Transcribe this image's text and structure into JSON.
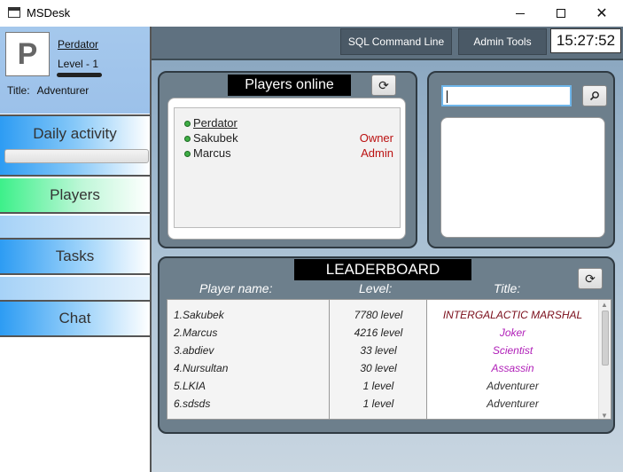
{
  "window": {
    "title": "MSDesk"
  },
  "profile": {
    "avatar_letter": "P",
    "name": "Perdator",
    "level": "Level - 1",
    "title_label": "Title:",
    "title_value": "Adventurer"
  },
  "nav": {
    "daily": "Daily activity",
    "players": "Players",
    "tasks": "Tasks",
    "chat": "Chat"
  },
  "toolbar": {
    "sql": "SQL Command Line",
    "admin": "Admin Tools",
    "clock": "15:27:52"
  },
  "players_online": {
    "title": "Players online",
    "players": [
      {
        "name": "Perdator",
        "role": ""
      },
      {
        "name": "Sakubek",
        "role": "Owner"
      },
      {
        "name": "Marcus",
        "role": "Admin"
      }
    ]
  },
  "search": {
    "value": ""
  },
  "leaderboard": {
    "title": "LEADERBOARD",
    "headers": {
      "name": "Player name:",
      "level": "Level:",
      "title": "Title:"
    },
    "rows": [
      {
        "name": "1.Sakubek",
        "level": "7780 level",
        "title": "INTERGALACTIC MARSHAL",
        "title_color": "#7a0d1a"
      },
      {
        "name": "2.Marcus",
        "level": "4216 level",
        "title": "Joker",
        "title_color": "#b01fb8"
      },
      {
        "name": "3.abdiev",
        "level": "33 level",
        "title": "Scientist",
        "title_color": "#b01fb8"
      },
      {
        "name": "4.Nursultan",
        "level": "30 level",
        "title": "Assassin",
        "title_color": "#b01fb8"
      },
      {
        "name": "5.LKIA",
        "level": "1 level",
        "title": "Adventurer",
        "title_color": "#333333"
      },
      {
        "name": "6.sdsds",
        "level": "1 level",
        "title": "Adventurer",
        "title_color": "#333333"
      }
    ]
  },
  "colors": {
    "accent_blue": "#2d9cf3",
    "active_green": "#3df08a",
    "owner_red": "#b11111"
  }
}
